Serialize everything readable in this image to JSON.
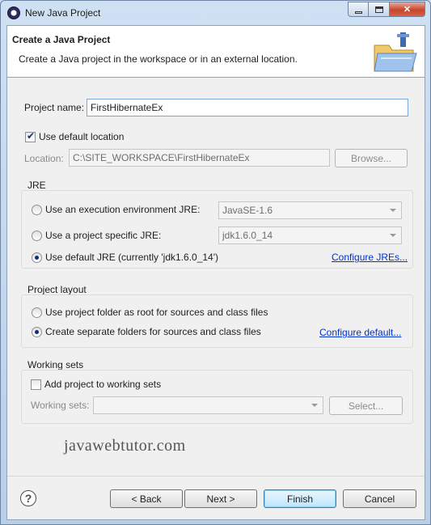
{
  "window": {
    "title": "New Java Project",
    "controls": {
      "minimize_icon": "minimize-icon",
      "maximize_icon": "maximize-icon",
      "close_icon": "close-icon"
    }
  },
  "banner": {
    "title": "Create a Java Project",
    "description": "Create a Java project in the workspace or in an external location.",
    "icon": "new-java-project-icon"
  },
  "project": {
    "name_label": "Project name:",
    "name_value": "FirstHibernateEx",
    "use_default_location_label": "Use default location",
    "use_default_location_checked": true,
    "location_label": "Location:",
    "location_value": "C:\\SITE_WORKSPACE\\FirstHibernateEx",
    "browse_label": "Browse..."
  },
  "jre": {
    "group_title": "JRE",
    "options": [
      {
        "label": "Use an execution environment JRE:",
        "selected": false,
        "combo_value": "JavaSE-1.6"
      },
      {
        "label": "Use a project specific JRE:",
        "selected": false,
        "combo_value": "jdk1.6.0_14"
      },
      {
        "label": "Use default JRE (currently 'jdk1.6.0_14')",
        "selected": true
      }
    ],
    "configure_link": "Configure JREs..."
  },
  "layout": {
    "group_title": "Project layout",
    "options": [
      {
        "label": "Use project folder as root for sources and class files",
        "selected": false
      },
      {
        "label": "Create separate folders for sources and class files",
        "selected": true
      }
    ],
    "configure_link": "Configure default..."
  },
  "working_sets": {
    "group_title": "Working sets",
    "add_label": "Add project to working sets",
    "add_checked": false,
    "sets_label": "Working sets:",
    "sets_value": "",
    "select_label": "Select..."
  },
  "watermark": "javawebtutor.com",
  "footer": {
    "help_icon": "help-icon",
    "back_label": "< Back",
    "next_label": "Next >",
    "finish_label": "Finish",
    "cancel_label": "Cancel"
  }
}
